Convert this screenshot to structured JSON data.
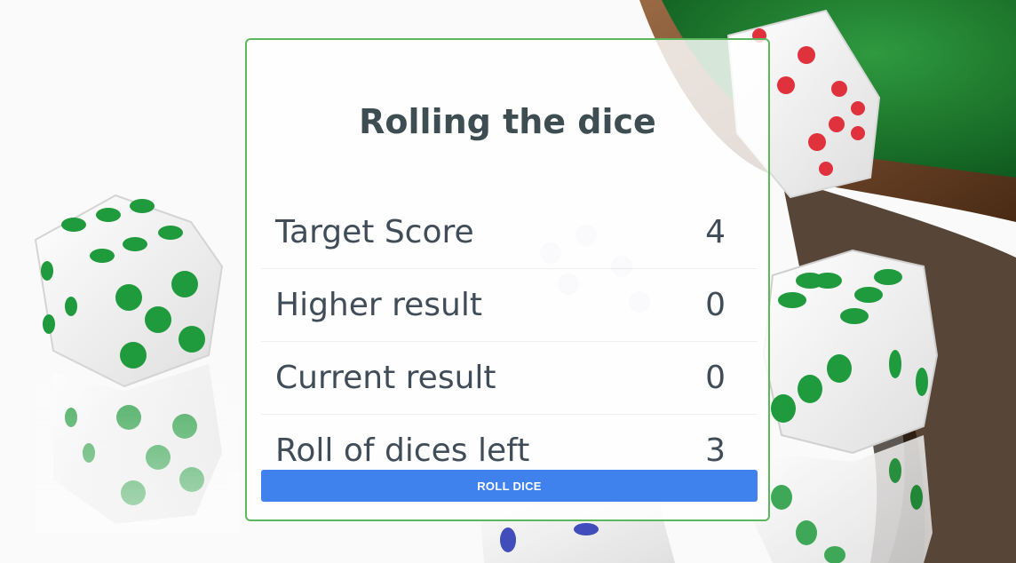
{
  "game": {
    "title": "Rolling the dice",
    "stats": [
      {
        "label": "Target Score",
        "value": "4"
      },
      {
        "label": "Higher result",
        "value": "0"
      },
      {
        "label": "Current result",
        "value": "0"
      },
      {
        "label": "Roll of dices left",
        "value": "3"
      }
    ],
    "roll_button_label": "ROLL DICE"
  },
  "colors": {
    "panel_border": "#5cb85c",
    "button": "#3f82ee",
    "text": "#404d59",
    "dice_green_pips": "#1f9a3c",
    "dice_red_pips": "#e0323c",
    "table_felt": "#1d7a2e",
    "table_wood": "#7a4a2a"
  }
}
